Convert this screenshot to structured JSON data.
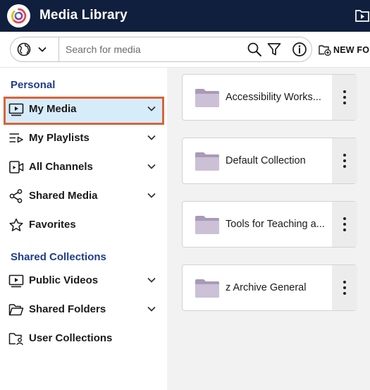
{
  "app": {
    "title": "Media Library",
    "header_bg": "#0f1f3d",
    "accent": "#1f3c8a",
    "selection_outline": "#d8643a",
    "selection_bg": "#d7ecfb"
  },
  "search": {
    "placeholder": "Search for media",
    "scope_icon": "globe-icon",
    "icons": [
      "search-icon",
      "filter-icon",
      "info-icon"
    ]
  },
  "toolbar": {
    "new_folder_label": "NEW FO"
  },
  "sidebar": {
    "personal_title": "Personal",
    "shared_title": "Shared Collections",
    "personal_items": [
      {
        "label": "My Media",
        "icon": "media-icon",
        "expandable": true,
        "selected": true
      },
      {
        "label": "My Playlists",
        "icon": "playlist-icon",
        "expandable": true
      },
      {
        "label": "All Channels",
        "icon": "channel-icon",
        "expandable": true
      },
      {
        "label": "Shared Media",
        "icon": "share-icon",
        "expandable": true
      },
      {
        "label": "Favorites",
        "icon": "star-icon",
        "expandable": false
      }
    ],
    "shared_items": [
      {
        "label": "Public Videos",
        "icon": "video-icon",
        "expandable": true
      },
      {
        "label": "Shared Folders",
        "icon": "folder-icon",
        "expandable": true
      },
      {
        "label": "User Collections",
        "icon": "user-folder-icon",
        "expandable": false
      }
    ]
  },
  "folders": [
    {
      "label": "Accessibility Works..."
    },
    {
      "label": "Default Collection"
    },
    {
      "label": "Tools for Teaching a..."
    },
    {
      "label": "z Archive General"
    }
  ]
}
